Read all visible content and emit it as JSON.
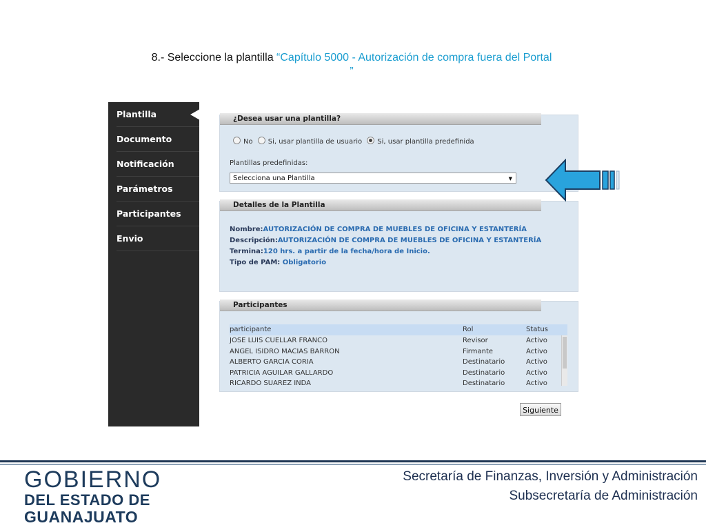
{
  "slide": {
    "title_prefix": "8.- Seleccione la plantilla ",
    "title_highlight": "“Capítulo 5000 - Autorización de compra fuera del Portal",
    "title_close": "”"
  },
  "sidebar": {
    "items": [
      {
        "label": "Plantilla"
      },
      {
        "label": "Documento"
      },
      {
        "label": "Notificación"
      },
      {
        "label": "Parámetros"
      },
      {
        "label": "Participantes"
      },
      {
        "label": "Envio"
      }
    ]
  },
  "template_panel": {
    "header": "¿Desea usar una plantilla?",
    "options": [
      "No",
      "Si, usar plantilla de usuario",
      "Si, usar plantilla predefinida"
    ],
    "selected_option": "Si, usar plantilla predefinida",
    "predef_label": "Plantillas predefinidas:",
    "select_value": "Selecciona una Plantilla"
  },
  "details_panel": {
    "header": "Detalles de la Plantilla",
    "nombre_label": "Nombre:",
    "nombre_value": "AUTORIZACIÓN DE COMPRA DE MUEBLES DE OFICINA Y ESTANTERÍA",
    "descripcion_label": "Descripción:",
    "descripcion_value": "AUTORIZACIÓN DE COMPRA DE MUEBLES DE OFICINA Y ESTANTERÍA",
    "termina_label": "Termina:",
    "termina_value": "120 hrs. a partir de la fecha/hora de Inicio.",
    "tipo_label": "Tipo de PAM: ",
    "tipo_value": "Obligatorio"
  },
  "participants_panel": {
    "header": "Participantes",
    "columns": [
      "participante",
      "Rol",
      "Status"
    ],
    "rows": [
      [
        "JOSE LUIS CUELLAR FRANCO",
        "Revisor",
        "Activo"
      ],
      [
        "ANGEL ISIDRO MACIAS BARRON",
        "Firmante",
        "Activo"
      ],
      [
        "ALBERTO GARCIA CORIA",
        "Destinatario",
        "Activo"
      ],
      [
        "PATRICIA AGUILAR GALLARDO",
        "Destinatario",
        "Activo"
      ],
      [
        "RICARDO SUAREZ INDA",
        "Destinatario",
        "Activo"
      ]
    ]
  },
  "next_button": "Siguiente",
  "footer": {
    "logo_line1": "GOBIERNO",
    "logo_line2": "DEL ESTADO DE",
    "logo_line3": "GUANAJUATO",
    "org_line1": "Secretaría de Finanzas, Inversión y Administración",
    "org_line2": "Subsecretaría de Administración"
  },
  "colors": {
    "accent_blue": "#1a9dd0",
    "sidebar_bg": "#2a2a2a",
    "panel_bg": "#dce7f1",
    "arrow_blue": "#29a3dd",
    "footer_navy": "#1d3b5c"
  }
}
